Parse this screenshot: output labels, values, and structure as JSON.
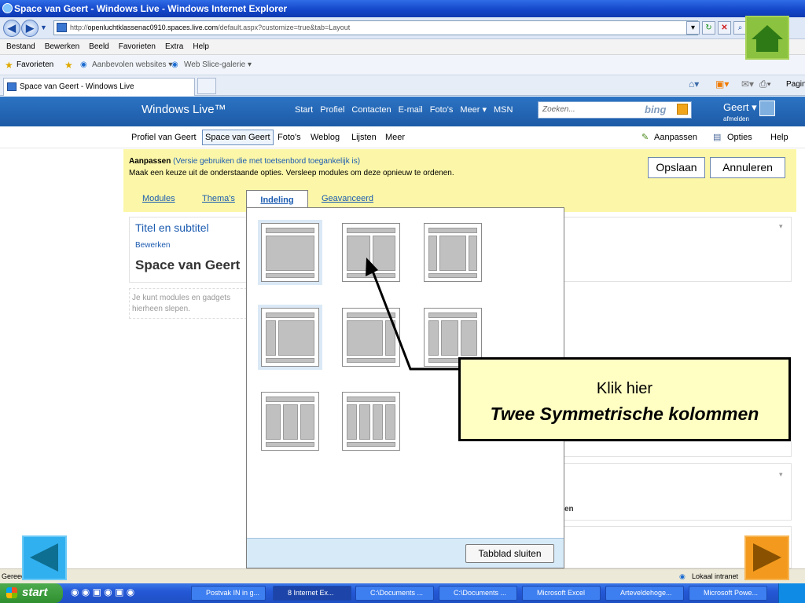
{
  "window": {
    "title": "Space van Geert - Windows Live - Windows Internet Explorer"
  },
  "address": {
    "url_prefix": "http://",
    "url_host": "openluchtklassenac0910.spaces.live.com",
    "url_rest": "/default.aspx?customize=true&tab=Layout"
  },
  "menu": [
    "Bestand",
    "Bewerken",
    "Beeld",
    "Favorieten",
    "Extra",
    "Help"
  ],
  "favorites": {
    "label": "Favorieten",
    "item1": "Aanbevolen websites ▾",
    "item2": "Web Slice-galerie ▾"
  },
  "tab": {
    "label": "Space van Geert - Windows Live",
    "page_label": "Pagina"
  },
  "wl": {
    "logo": "Windows Live™",
    "nav": [
      "Start",
      "Profiel",
      "Contacten",
      "E-mail",
      "Foto's",
      "Meer ▾",
      "MSN"
    ],
    "search_placeholder": "Zoeken...",
    "bing": "bing",
    "user": "Geert ▾",
    "signout": "afmelden"
  },
  "subnav": {
    "items": [
      "Profiel van Geert",
      "Space van Geert",
      "Foto's",
      "Weblog",
      "Lijsten",
      "Meer"
    ],
    "customize": "Aanpassen",
    "options": "Opties",
    "help": "Help"
  },
  "customize": {
    "title": "Aanpassen",
    "accessible": "(Versie gebruiken die met toetsenbord toegankelijk is)",
    "instructions": "Maak een keuze uit de onderstaande opties. Versleep modules om deze opnieuw te ordenen.",
    "save": "Opslaan",
    "cancel": "Annuleren",
    "tabs": [
      "Modules",
      "Thema's",
      "Indeling",
      "Geavanceerd"
    ]
  },
  "page": {
    "box_title": "Titel en subtitel",
    "box_edit": "Bewerken",
    "space_name": "Space van Geert",
    "drop_hint": "Je kunt modules en gadgets hierheen slepen.",
    "partial_text": "en"
  },
  "panel": {
    "close": "Tabblad sluiten"
  },
  "callout": {
    "line1": "Klik hier",
    "line2": "Twee Symmetrische kolommen"
  },
  "status": {
    "left": "Gereed",
    "zone": "Lokaal intranet"
  },
  "taskbar": {
    "start": "start",
    "items": [
      "Postvak IN in g...",
      "8 Internet Ex...",
      "C:\\Documents ...",
      "C:\\Documents ...",
      "Microsoft Excel",
      "Arteveldehoge...",
      "Microsoft Powe..."
    ]
  }
}
